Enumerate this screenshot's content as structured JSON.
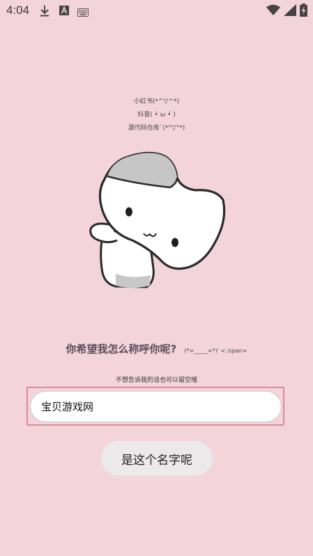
{
  "status_bar": {
    "time": "4:04",
    "icons": [
      "download-icon",
      "a-icon",
      "keyboard-icon",
      "wifi-icon",
      "signal-icon",
      "battery-icon"
    ]
  },
  "social": {
    "lines": [
      "小红书(*^▽^*)",
      "抖音( •̀ ω •́ )",
      "源代码仓库`(*°▽°*)"
    ]
  },
  "question": {
    "main": "你希望我怎么称呼你呢?",
    "extra": "(*>_____<*)' < /span>"
  },
  "hint": "不想告诉我的话也可以留空哦",
  "input": {
    "value": "宝贝游戏网"
  },
  "confirm_label": "是这个名字呢",
  "colors": {
    "background": "#f3d4da",
    "input_border": "#d9899b",
    "button": "#ebe9ea",
    "question": "#5d4c5a"
  }
}
